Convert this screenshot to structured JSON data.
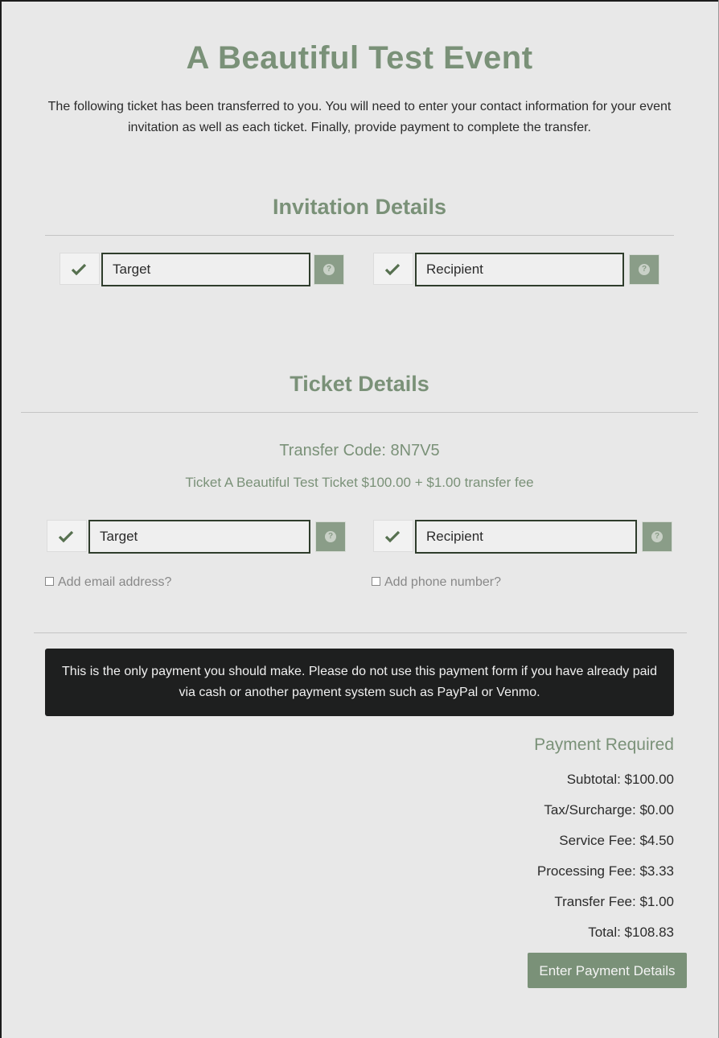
{
  "event": {
    "title": "A Beautiful Test Event",
    "intro": "The following ticket has been transferred to you. You will need to enter your contact information for your event invitation as well as each ticket. Finally, provide payment to complete the transfer."
  },
  "invitation": {
    "heading": "Invitation Details",
    "first_name": "Target",
    "last_name": "Recipient"
  },
  "ticket": {
    "heading": "Ticket Details",
    "transfer_code": "Transfer Code: 8N7V5",
    "description": "Ticket A Beautiful Test Ticket $100.00 + $1.00 transfer fee",
    "first_name": "Target",
    "last_name": "Recipient",
    "add_email_label": "Add email address?",
    "add_phone_label": "Add phone number?"
  },
  "warning": {
    "text": "This is the only payment you should make. Please do not use this payment form if you have already paid via cash or another payment system such as PayPal or Venmo."
  },
  "payment": {
    "heading": "Payment Required",
    "subtotal": "Subtotal: $100.00",
    "tax": "Tax/Surcharge: $0.00",
    "service_fee": "Service Fee: $4.50",
    "processing_fee": "Processing Fee: $3.33",
    "transfer_fee": "Transfer Fee: $1.00",
    "total": "Total: $108.83",
    "button_label": "Enter Payment Details"
  },
  "icons": {
    "valid": "check-icon",
    "help": "question-icon"
  },
  "colors": {
    "accent": "#7a9178",
    "background": "#e8e8e8",
    "warning_bg": "#1e1f1f"
  }
}
